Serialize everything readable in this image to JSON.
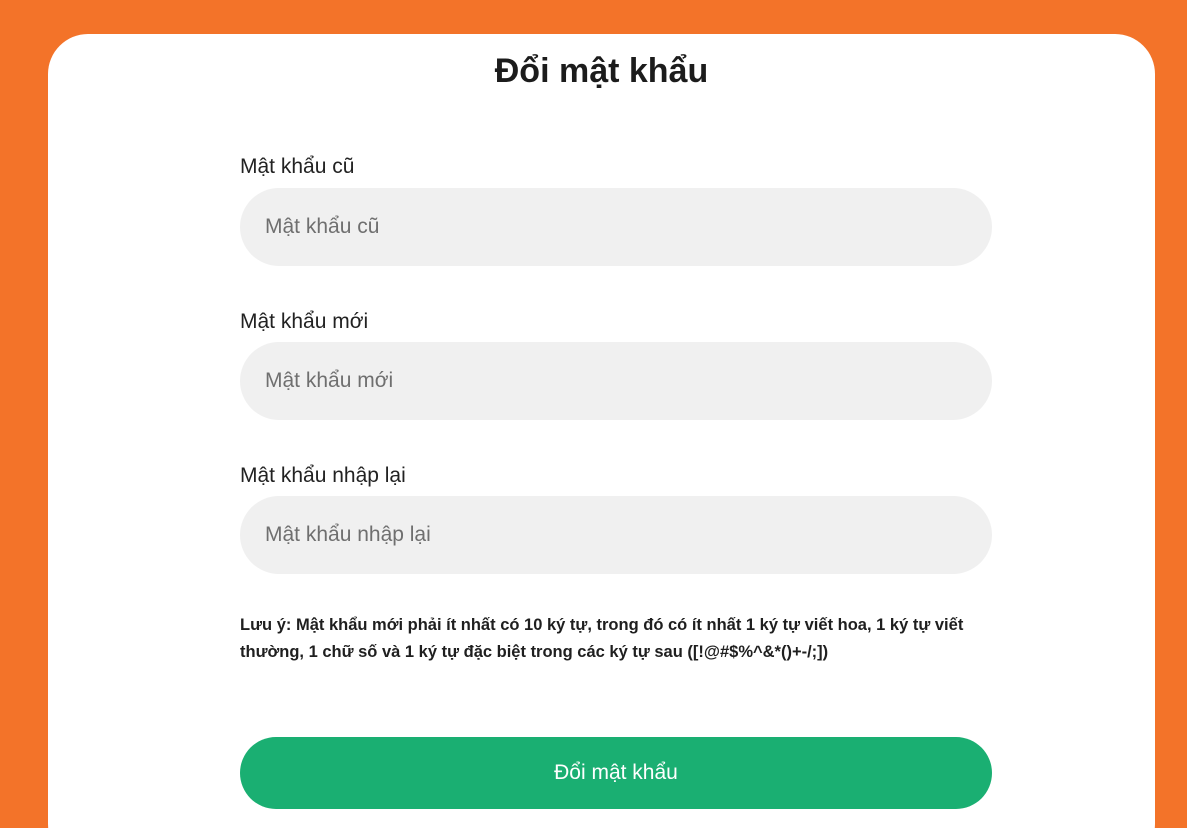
{
  "title": "Đổi mật khẩu",
  "fields": [
    {
      "label": "Mật khẩu cũ",
      "placeholder": "Mật khẩu cũ"
    },
    {
      "label": "Mật khẩu mới",
      "placeholder": "Mật khẩu mới"
    },
    {
      "label": "Mật khẩu nhập lại",
      "placeholder": "Mật khẩu nhập lại"
    }
  ],
  "note": "Lưu ý: Mật khẩu mới phải ít nhất có 10 ký tự, trong đó có ít nhất 1 ký tự viết hoa, 1 ký tự viết thường, 1 chữ số và 1 ký tự đặc biệt trong các ký tự sau ([!@#$%^&*()+-/;])",
  "submit_label": "Đổi mật khẩu",
  "colors": {
    "background": "#f37329",
    "card": "#ffffff",
    "input_bg": "#f0f0f0",
    "button": "#1aaf72"
  }
}
